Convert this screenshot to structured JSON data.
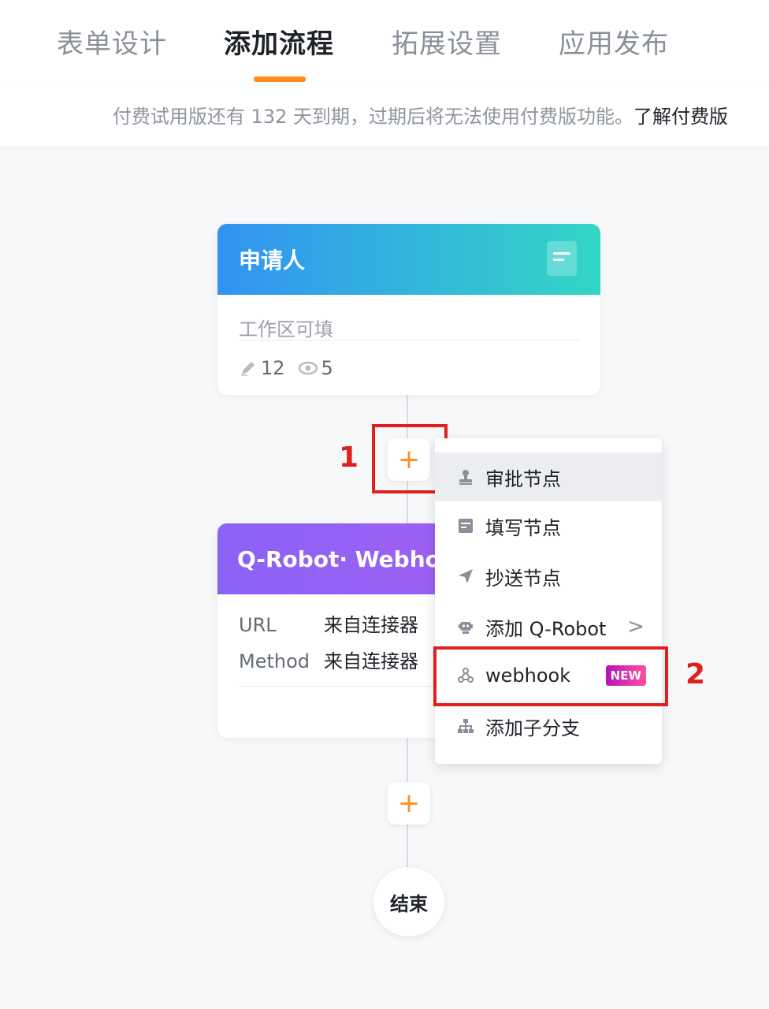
{
  "tabs": [
    {
      "label": "表单设计"
    },
    {
      "label": "添加流程"
    },
    {
      "label": "拓展设置"
    },
    {
      "label": "应用发布"
    }
  ],
  "notice": {
    "text": "付费试用版还有 132 天到期，过期后将无法使用付费版功能。",
    "link": "了解付费版"
  },
  "applicant_card": {
    "title": "申请人",
    "subtitle": "工作区可填",
    "edit_count": "12",
    "view_count": "5"
  },
  "robot_card": {
    "title": "Q-Robot· Webhook",
    "rows": [
      {
        "key": "URL",
        "value": "来自连接器"
      },
      {
        "key": "Method",
        "value": "来自连接器"
      }
    ]
  },
  "plus_label": "+",
  "menu": {
    "items": [
      {
        "label": "审批节点"
      },
      {
        "label": "填写节点"
      },
      {
        "label": "抄送节点"
      },
      {
        "label": "添加 Q-Robot",
        "chevron": ">"
      },
      {
        "label": "webhook",
        "badge": "NEW"
      },
      {
        "label": "添加子分支"
      }
    ]
  },
  "annotations": {
    "one": "1",
    "two": "2"
  },
  "end_node": {
    "label": "结束"
  },
  "colors": {
    "accent": "#ff8f1f",
    "annotation_red": "#e0201d"
  }
}
